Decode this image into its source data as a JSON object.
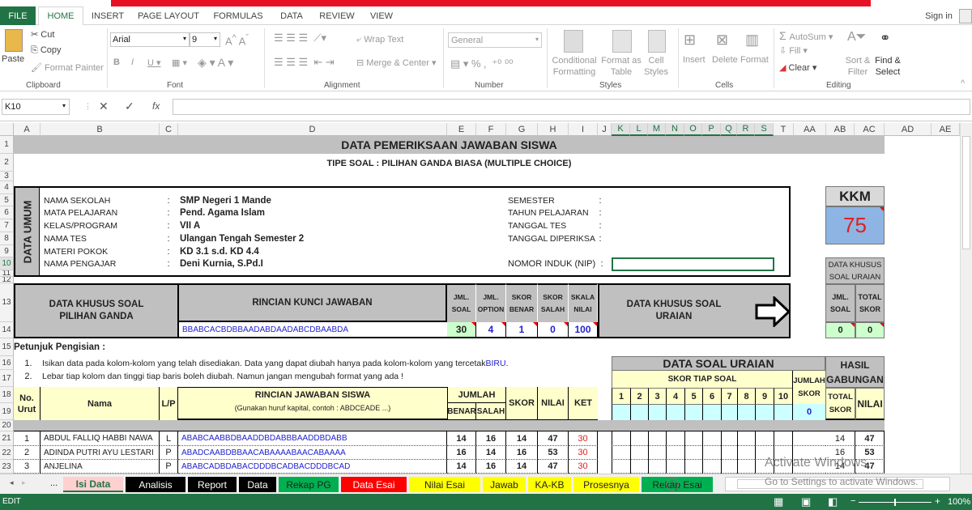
{
  "ribbon": {
    "tabs": [
      "FILE",
      "HOME",
      "INSERT",
      "PAGE LAYOUT",
      "FORMULAS",
      "DATA",
      "REVIEW",
      "VIEW"
    ],
    "sign_in": "Sign in",
    "paste": "Paste",
    "cut": "Cut",
    "copy": "Copy",
    "format_painter": "Format Painter",
    "font_name": "Arial",
    "font_size": "9",
    "wrap_text": "Wrap Text",
    "merge_center": "Merge & Center",
    "number_format": "General",
    "conditional": "Conditional Formatting",
    "format_table": "Format as Table",
    "cell_styles": "Cell Styles",
    "insert": "Insert",
    "delete": "Delete",
    "format": "Format",
    "autosum": "AutoSum",
    "fill": "Fill",
    "clear": "Clear",
    "sort": "Sort & Filter",
    "find": "Find & Select",
    "groups": [
      "Clipboard",
      "Font",
      "Alignment",
      "Number",
      "Styles",
      "Cells",
      "Editing"
    ]
  },
  "formula_bar": {
    "name_box": "K10",
    "fx": "fx",
    "value": ""
  },
  "columns": [
    "A",
    "B",
    "C",
    "D",
    "E",
    "F",
    "G",
    "H",
    "I",
    "J",
    "K",
    "L",
    "M",
    "N",
    "O",
    "P",
    "Q",
    "R",
    "S",
    "T",
    "AA",
    "AB",
    "AC",
    "AD",
    "AE"
  ],
  "selected_columns": [
    "K",
    "L",
    "M",
    "N",
    "O",
    "P",
    "Q",
    "R",
    "S"
  ],
  "rows": [
    "1",
    "2",
    "3",
    "4",
    "5",
    "6",
    "7",
    "8",
    "9",
    "10",
    "11",
    "12",
    "13",
    "14",
    "15",
    "16",
    "17",
    "18",
    "19",
    "20",
    "21",
    "22",
    "23"
  ],
  "sheet": {
    "title": "DATA PEMERIKSAAN JAWABAN SISWA",
    "subtitle": "TIPE SOAL : PILIHAN GANDA BIASA (MULTIPLE CHOICE)",
    "data_umum": "DATA UMUM",
    "info_left": [
      {
        "label": "NAMA SEKOLAH",
        "value": "SMP Negeri 1 Mande"
      },
      {
        "label": "MATA PELAJARAN",
        "value": "Pend. Agama Islam"
      },
      {
        "label": "KELAS/PROGRAM",
        "value": "VII A"
      },
      {
        "label": "NAMA TES",
        "value": "Ulangan Tengah Semester 2"
      },
      {
        "label": "MATERI POKOK",
        "value": "KD 3.1 s.d. KD 4.4"
      },
      {
        "label": "NAMA PENGAJAR",
        "value": "Deni Kurnia, S.Pd.I"
      }
    ],
    "info_right": [
      {
        "label": "SEMESTER"
      },
      {
        "label": "TAHUN PELAJARAN"
      },
      {
        "label": "TANGGAL TES"
      },
      {
        "label": "TANGGAL DIPERIKSA"
      }
    ],
    "colon": ":",
    "nip_label": "NOMOR INDUK (NIP)",
    "nip_value": "",
    "kkm_label": "KKM",
    "kkm_value": "75",
    "uraian_box": {
      "title": "DATA KHUSUS SOAL URAIAN",
      "jml_soal": "JML. SOAL",
      "total_skor": "TOTAL SKOR",
      "jml_value": "0",
      "total_value": "0"
    },
    "pg_title": "DATA KHUSUS SOAL PILIHAN GANDA",
    "kunci_title": "RINCIAN KUNCI JAWABAN",
    "kunci_value": "BBABCACBDBBAADABDAADABCDBAABDA",
    "pg_headers": [
      "JML. SOAL",
      "JML. OPTION",
      "SKOR BENAR",
      "SKOR SALAH",
      "SKALA NILAI"
    ],
    "pg_values": [
      "30",
      "4",
      "1",
      "0",
      "100"
    ],
    "uraian_arrow_label": "DATA KHUSUS SOAL URAIAN",
    "petunjuk_title": "Petunjuk Pengisian :",
    "petunjuk": [
      {
        "num": "1.",
        "text": "Isikan data pada kolom-kolom yang telah disediakan. Data yang dapat diubah hanya pada kolom-kolom yang tercetak ",
        "highlight": "BIRU",
        "end": "."
      },
      {
        "num": "2.",
        "text": "Lebar tiap kolom dan tinggi tiap baris boleh diubah. Namun jangan mengubah format yang ada !"
      }
    ],
    "table_headers": {
      "no": "No. Urut",
      "nama": "Nama",
      "lp": "L/P",
      "rincian": "RINCIAN JAWABAN SISWA",
      "rincian_sub": "(Gunakan huruf kapital, contoh : ABDCEADE ...)",
      "jumlah": "JUMLAH",
      "benar": "BENAR",
      "salah": "SALAH",
      "skor": "SKOR",
      "nilai": "NILAI",
      "ket": "KET"
    },
    "uraian_table": {
      "title": "DATA SOAL URAIAN",
      "skor_tiap": "SKOR TIAP SOAL",
      "nums": [
        "1",
        "2",
        "3",
        "4",
        "5",
        "6",
        "7",
        "8",
        "9",
        "10"
      ],
      "jumlah_skor": "JUMLAH SKOR",
      "jumlah_value": "0",
      "hasil": "HASIL GABUNGAN",
      "total_skor": "TOTAL SKOR",
      "nilai": "NILAI"
    },
    "students": [
      {
        "no": "1",
        "nama": "ABDUL FALLIQ HABBI NAWA",
        "lp": "L",
        "jawaban": "ABABCAABBDBAADDBDABBBAADDBDABB",
        "benar": "14",
        "salah": "16",
        "skor": "14",
        "nilai": "47",
        "ket": "30",
        "total": "14",
        "nilai_gab": "47"
      },
      {
        "no": "2",
        "nama": "ADINDA PUTRI AYU LESTARI",
        "lp": "P",
        "jawaban": "ABADCAABDBBAACABAAAABAACABAAAA",
        "benar": "16",
        "salah": "14",
        "skor": "16",
        "nilai": "53",
        "ket": "30",
        "total": "16",
        "nilai_gab": "53"
      },
      {
        "no": "3",
        "nama": "ANJELINA",
        "lp": "P",
        "jawaban": "ABABCADBDABACDDDBCADBACDDDBCAD",
        "benar": "14",
        "salah": "16",
        "skor": "14",
        "nilai": "47",
        "ket": "30",
        "total": "14",
        "nilai_gab": "47"
      }
    ]
  },
  "sheet_tabs": [
    {
      "label": "Isi Data",
      "bg": "#ffd0d0",
      "fg": "#217346",
      "active": true
    },
    {
      "label": "Analisis",
      "bg": "#000000",
      "fg": "#ffffff"
    },
    {
      "label": "Report",
      "bg": "#000000",
      "fg": "#ffffff"
    },
    {
      "label": "Data",
      "bg": "#000000",
      "fg": "#ffffff"
    },
    {
      "label": "Rekap PG",
      "bg": "#00b050",
      "fg": "#222222"
    },
    {
      "label": "Data Esai",
      "bg": "#ff0000",
      "fg": "#ffffff"
    },
    {
      "label": "Nilai Esai",
      "bg": "#ffff00",
      "fg": "#222222"
    },
    {
      "label": "Jawab",
      "bg": "#ffff00",
      "fg": "#222222"
    },
    {
      "label": "KA-KB",
      "bg": "#ffff00",
      "fg": "#222222"
    },
    {
      "label": "Prosesnya",
      "bg": "#ffff00",
      "fg": "#222222"
    },
    {
      "label": "Rekap Esai",
      "bg": "#00b050",
      "fg": "#222222"
    }
  ],
  "ellipsis": "...",
  "watermark": {
    "line1": "Activate Windows",
    "line2": "Go to Settings to activate Windows."
  },
  "status": {
    "mode": "EDIT",
    "zoom": "100%"
  },
  "colors": {
    "excel_green": "#217346",
    "title_red": "#e81123",
    "kkm_bg": "#8db4e2",
    "header_gray": "#c0c0c0",
    "input_yellow": "#ffffcc"
  }
}
